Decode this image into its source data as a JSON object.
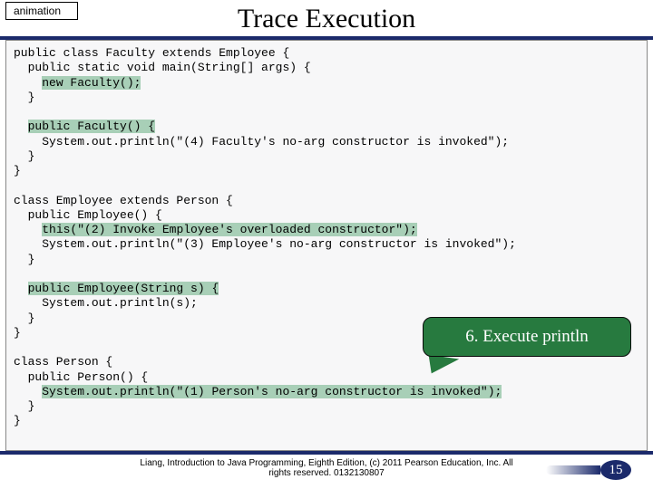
{
  "badge": "animation",
  "title": "Trace Execution",
  "code": {
    "l1": "public class Faculty extends Employee {",
    "l2": "  public static void main(String[] args) {",
    "l3a": "    ",
    "l3b": "new Faculty();",
    "l4": "  }",
    "l5": "",
    "l6a": "  ",
    "l6b": "public Faculty() {",
    "l7": "    System.out.println(\"(4) Faculty's no-arg constructor is invoked\");",
    "l8": "  }",
    "l9": "}",
    "l10": "",
    "l11": "class Employee extends Person {",
    "l12": "  public Employee() {",
    "l13a": "    ",
    "l13b": "this(\"(2) Invoke Employee's overloaded constructor\");",
    "l14": "    System.out.println(\"(3) Employee's no-arg constructor is invoked\");",
    "l15": "  }",
    "l16": "",
    "l17a": "  ",
    "l17b": "public Employee(String s) {",
    "l18": "    System.out.println(s);",
    "l19": "  }",
    "l20": "}",
    "l21": "",
    "l22": "class Person {",
    "l23": "  public Person() {",
    "l24a": "    ",
    "l24b": "System.out.println(\"(1) Person's no-arg constructor is invoked\");",
    "l25": "  }",
    "l26": "}"
  },
  "callout": "6. Execute println",
  "footer_line1": "Liang, Introduction to Java Programming, Eighth Edition, (c) 2011 Pearson Education, Inc. All",
  "footer_line2": "rights reserved. 0132130807",
  "page": "15"
}
